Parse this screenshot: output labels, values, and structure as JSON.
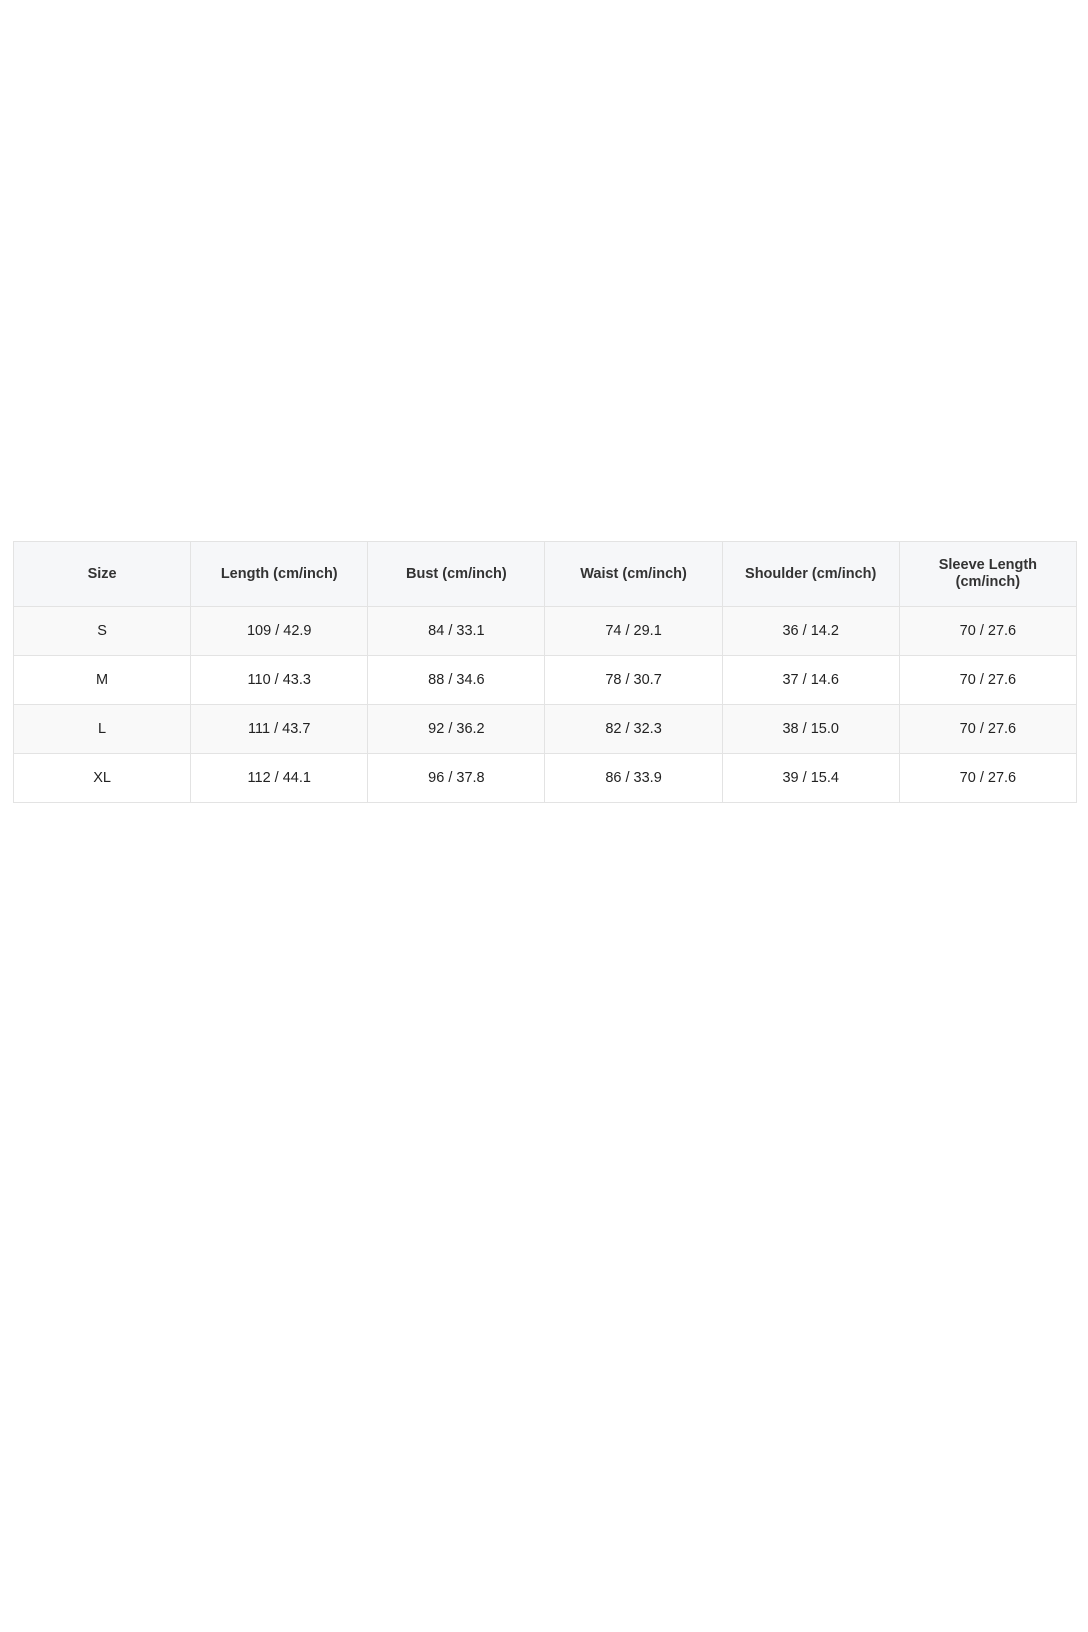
{
  "chart_data": {
    "type": "table",
    "columns": [
      "Size",
      "Length (cm/inch)",
      "Bust (cm/inch)",
      "Waist (cm/inch)",
      "Shoulder (cm/inch)",
      "Sleeve Length (cm/inch)"
    ],
    "rows": [
      [
        "S",
        "109 / 42.9",
        "84 / 33.1",
        "74 / 29.1",
        "36 / 14.2",
        "70 / 27.6"
      ],
      [
        "M",
        "110 / 43.3",
        "88 / 34.6",
        "78 / 30.7",
        "37 / 14.6",
        "70 / 27.6"
      ],
      [
        "L",
        "111 / 43.7",
        "92 / 36.2",
        "82 / 32.3",
        "38 / 15.0",
        "70 / 27.6"
      ],
      [
        "XL",
        "112 / 44.1",
        "96 / 37.8",
        "86 / 33.9",
        "39 / 15.4",
        "70 / 27.6"
      ]
    ]
  },
  "colors": {
    "header_bg": "#f6f7f9",
    "stripe_bg": "#f9f9f9",
    "border": "#e3e3e3"
  }
}
